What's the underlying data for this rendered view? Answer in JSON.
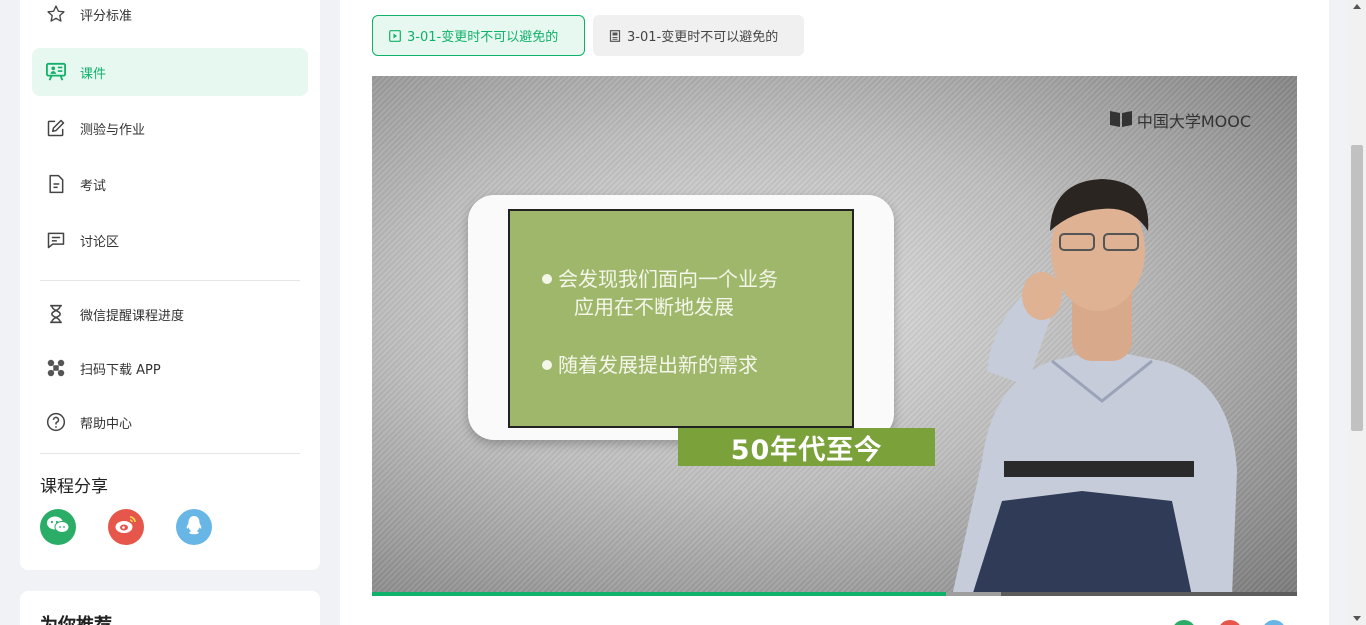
{
  "sidebar": {
    "items": [
      {
        "label": "评分标准",
        "icon": "star-icon"
      },
      {
        "label": "课件",
        "icon": "courseware-icon",
        "active": true
      },
      {
        "label": "测验与作业",
        "icon": "edit-icon"
      },
      {
        "label": "考试",
        "icon": "document-icon"
      },
      {
        "label": "讨论区",
        "icon": "chat-icon"
      }
    ],
    "extra_items": [
      {
        "label": "微信提醒课程进度",
        "icon": "hourglass-icon"
      },
      {
        "label": "扫码下载 APP",
        "icon": "app-icon"
      },
      {
        "label": "帮助中心",
        "icon": "help-icon"
      }
    ],
    "share_title": "课程分享",
    "share": [
      {
        "name": "wechat-icon",
        "color": "#2aae67"
      },
      {
        "name": "weibo-icon",
        "color": "#e6564a"
      },
      {
        "name": "qq-icon",
        "color": "#68b6e6"
      }
    ],
    "recommend_title": "为你推荐"
  },
  "main": {
    "tabs": [
      {
        "label": "3-01-变更时不可以避免的",
        "icon": "video-icon",
        "active": true
      },
      {
        "label": "3-01-变更时不可以避免的",
        "icon": "document-icon"
      }
    ],
    "video": {
      "brand": "中国大学MOOC",
      "slide_bullets": [
        "会发现我们面向一个业务",
        "应用在不断地发展",
        "随着发展提出新的需求"
      ],
      "caption": "50年代至今",
      "progress": 0.62,
      "buffered": 0.68
    }
  },
  "colors": {
    "accent": "#10b16a",
    "accent_bg": "#e7f8f0",
    "slide_green": "#9fb76b",
    "caption_green": "#7ba23a"
  }
}
